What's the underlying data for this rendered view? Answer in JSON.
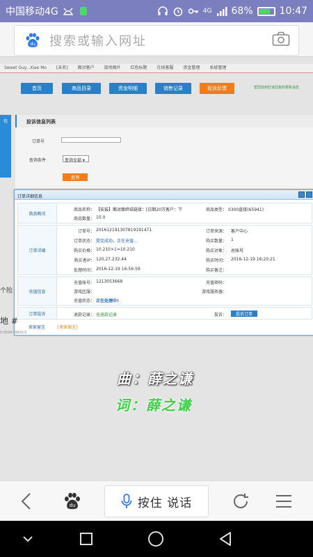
{
  "status_bar": {
    "carrier": "中国移动4G",
    "battery": "68%",
    "time": "10:47",
    "network": "4G"
  },
  "address_bar": {
    "placeholder": "搜索或输入网址",
    "logo_text": "du"
  },
  "bookmarks": [
    "Sweet Guy...Xiao Mo",
    "[未名]",
    "面对客户",
    "现场图片",
    "红色标题",
    "在线客服",
    "资金管理",
    "系统管理"
  ],
  "nav": {
    "items": [
      "首页",
      "商品目录",
      "资金明细",
      "销售记录",
      "投诉反馈"
    ],
    "tip": "帮您找到应该回复的那条消息"
  },
  "left_tab": "包",
  "panel": {
    "title": "投诉信息列表",
    "order_no_label": "订单号",
    "status_label": "查询条件",
    "status_value": "查询全部",
    "query_button": "查询"
  },
  "dialog": {
    "title": "订单详细信息",
    "product": {
      "section": "商品概况",
      "name_label": "商品名称：",
      "name_value": "【安装】面对面终结链接：[日期20万客户：下",
      "type_label": "商品类型：",
      "type_value": "0300直接(65941)",
      "qty_label": "商品数量：",
      "qty_value": "10.0"
    },
    "order": {
      "section": "订单详细",
      "rows": [
        {
          "l1": "订单号：",
          "v1": "201612191307819191471",
          "l2": "订单来源：",
          "v2": "客户中心"
        },
        {
          "l1": "订单状态：",
          "v1": "提交成功，正在充值…",
          "l2": "购买数量：",
          "v2": "1"
        },
        {
          "l1": "购买价格：",
          "v1": "10.210×1=10.210",
          "l2": "购买对象：",
          "v2": "总账号"
        },
        {
          "l1": "购买者IP：",
          "v1": "120.27.232.44",
          "l2": "购买时间：",
          "v2": "2016-12-19 16:20:21"
        },
        {
          "l1": "处理时间：",
          "v1": "2016-12-19 16:56:59",
          "l2": "购买备注：",
          "v2": ""
        }
      ]
    },
    "recharge": {
      "section": "充值信息",
      "rows": [
        {
          "l1": "充值账号：",
          "v1": "1213053668",
          "l2": "充值密码：",
          "v2": ""
        },
        {
          "l1": "游戏区服：",
          "v1": "",
          "l2": "游戏服务器：",
          "v2": ""
        },
        {
          "l1": "充值状态：",
          "v1": "正在处理中!",
          "l2": "",
          "v2": ""
        }
      ]
    },
    "complaint": {
      "section": "订单投诉",
      "record_label": "退款记录：",
      "record_value": "无退款记录",
      "complaint_label": "投诉：",
      "button": "投诉订单"
    },
    "notes": {
      "section": "卖家留言",
      "value": "[卖家留言]"
    }
  },
  "left_fragments": {
    "a": "个险",
    "b": "地 #",
    "c": "0 0594-\n9600,0"
  },
  "captions": {
    "line1": "曲：薛之谦",
    "line2": "词：薛之谦"
  },
  "toolbar": {
    "voice_label": "按住 说话",
    "logo_text": "du"
  },
  "colors": {
    "status_bar": "#7b7fbf",
    "nav_blue": "#2a7fc9",
    "nav_orange": "#f07c1e",
    "caption_green": "#3fd04a"
  }
}
